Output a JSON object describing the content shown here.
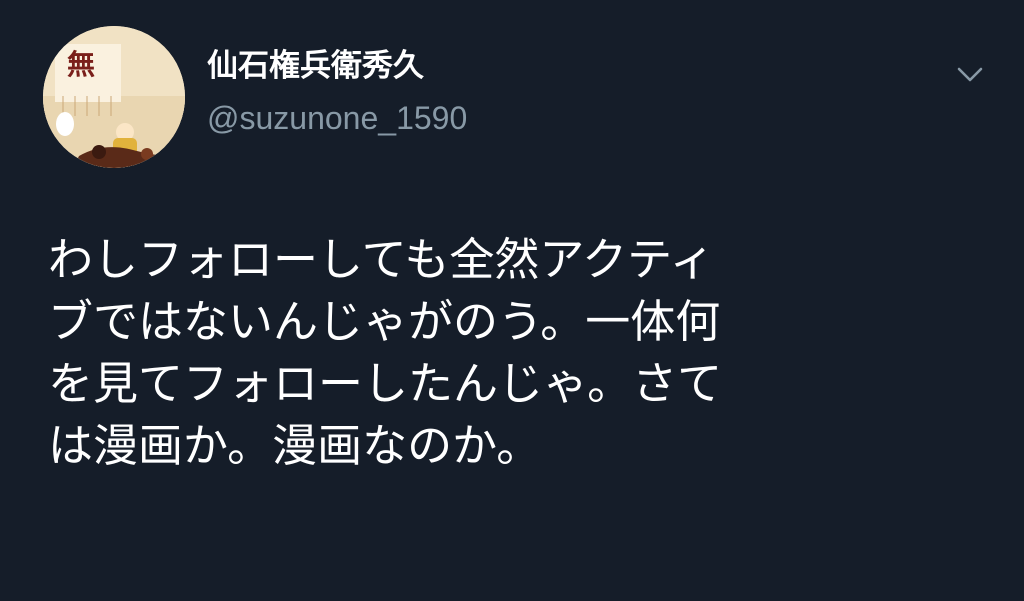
{
  "tweet": {
    "author": {
      "display_name": "仙石権兵衛秀久",
      "handle": "@suzunone_1590",
      "avatar_glyph": "無"
    },
    "menu_icon": "chevron-down-icon",
    "text_lines": [
      "わしフォローしても全然アクティ",
      "ブではないんじゃがのう。一体何",
      "を見てフォローしたんじゃ。さて",
      "は漫画か。漫画なのか。"
    ]
  },
  "colors": {
    "background": "#151d29",
    "text_primary": "#ffffff",
    "text_secondary": "#8899a6",
    "icon": "#8899a6"
  }
}
